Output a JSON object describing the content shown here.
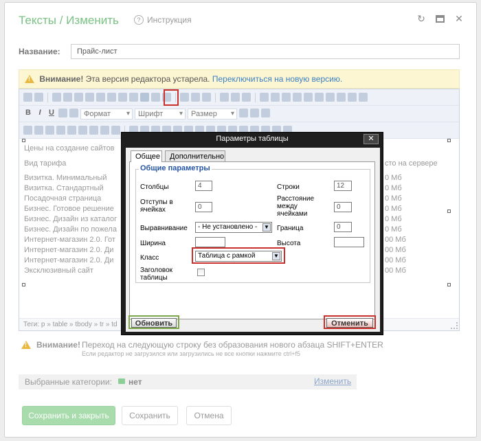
{
  "window": {
    "title": "Тексты / Изменить",
    "help_label": "Инструкция",
    "help_icon": "?"
  },
  "name_field": {
    "label": "Название:",
    "value": "Прайс-лист"
  },
  "warning": {
    "bold": "Внимание!",
    "text": " Эта версия редактора устарела. ",
    "link": "Переключиться на новую версию."
  },
  "toolbar": {
    "bold": "B",
    "italic": "I",
    "underline": "U",
    "format_select": "Формат",
    "font_select": "Шрифт",
    "size_select": "Размер"
  },
  "editor_content": {
    "table_title": "Цены на создание сайтов",
    "header_left": "Вид тарифа",
    "header_right": "сто на сервере",
    "rows": [
      {
        "left": "Визитка. Минимальный",
        "right": "0 Мб"
      },
      {
        "left": "Визитка. Стандартный",
        "right": "0 Мб"
      },
      {
        "left": "Посадочная страница",
        "right": "0 Мб"
      },
      {
        "left": "Бизнес. Готовое решение",
        "right": "0 Мб"
      },
      {
        "left": "Бизнес. Дизайн из каталог",
        "right": "0 Мб"
      },
      {
        "left": "Бизнес. Дизайн по пожела",
        "right": "0 Мб"
      },
      {
        "left": "Интернет-магазин 2.0. Гот",
        "right": "00 Мб"
      },
      {
        "left": "Интернет-магазин 2.0. Ди",
        "right": "00 Мб"
      },
      {
        "left": "Интернет-магазин 2.0. Ди",
        "right": "00 Мб"
      },
      {
        "left": "Эксклюзивный сайт",
        "right": "00 Мб"
      }
    ],
    "status_path": "Теги: p » table » tbody » tr » td"
  },
  "hint": {
    "bold": "Внимание!",
    "text": "Переход на следующую строку без образования нового абзаца SHIFT+ENTER",
    "subtext": "Если редактор не загрузился или загрузились не все кнопки нажмите ctrl+f5"
  },
  "categories": {
    "label": "Выбранные категории:",
    "value": "нет",
    "change_link": "Изменить"
  },
  "buttons": {
    "save_close": "Сохранить и закрыть",
    "save": "Сохранить",
    "cancel": "Отмена"
  },
  "dialog": {
    "title": "Параметры таблицы",
    "close": "✕",
    "tabs": [
      "Общее",
      "Дополнительно"
    ],
    "legend": "Общие параметры",
    "labels": {
      "columns": "Столбцы",
      "rows": "Строки",
      "cellpadding": "Отступы в ячейках",
      "cellspacing": "Расстояние между ячейками",
      "align": "Выравнивание",
      "border": "Граница",
      "width": "Ширина",
      "height": "Высота",
      "class": "Класс",
      "header": "Заголовок таблицы"
    },
    "values": {
      "columns": "4",
      "rows": "12",
      "cellpadding": "0",
      "cellspacing": "0",
      "align": "- Не установлено -",
      "border": "0",
      "width": "",
      "height": "",
      "class": "Таблица с рамкой"
    },
    "update_button": "Обновить",
    "cancel_button": "Отменить"
  },
  "colors": {
    "title_green": "#79c383",
    "warning_bg": "#fcf6d2",
    "highlight_red": "#c9302c",
    "legend_blue": "#2555a6"
  }
}
